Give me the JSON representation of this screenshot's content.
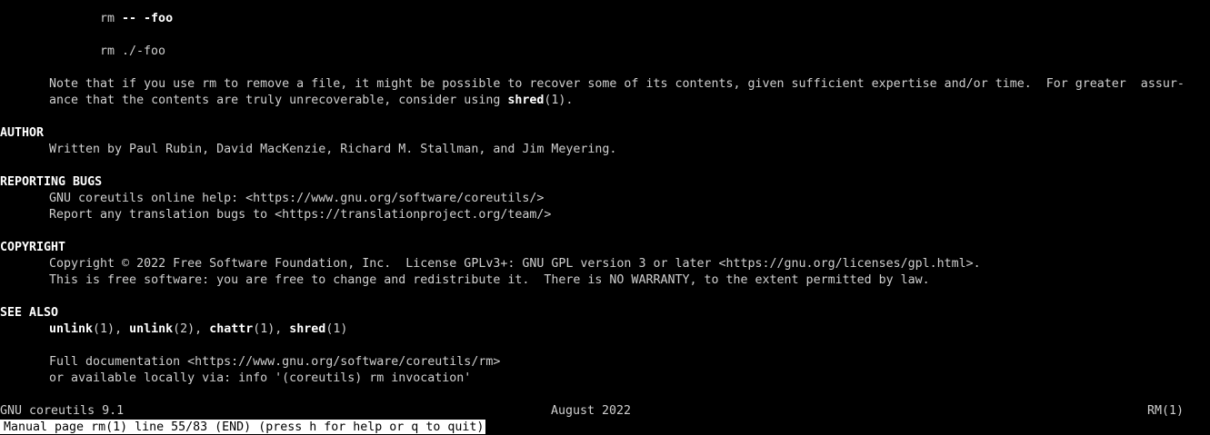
{
  "example": {
    "line1_cmd": "rm",
    "line1_sep": " -- ",
    "line1_arg": "-foo",
    "line2": "rm ./-foo"
  },
  "note": {
    "line1": "Note that if you use rm to remove a file, it might be possible to recover some of its contents, given sufficient expertise and/or time.  For greater  assur-",
    "line2_pre": "ance that the contents are truly unrecoverable, consider using ",
    "line2_cmd": "shred",
    "line2_post": "(1)."
  },
  "author": {
    "heading": "AUTHOR",
    "text": "Written by Paul Rubin, David MacKenzie, Richard M. Stallman, and Jim Meyering."
  },
  "bugs": {
    "heading": "REPORTING BUGS",
    "line1": "GNU coreutils online help: <https://www.gnu.org/software/coreutils/>",
    "line2": "Report any translation bugs to <https://translationproject.org/team/>"
  },
  "copyright": {
    "heading": "COPYRIGHT",
    "line1": "Copyright © 2022 Free Software Foundation, Inc.  License GPLv3+: GNU GPL version 3 or later <https://gnu.org/licenses/gpl.html>.",
    "line2": "This is free software: you are free to change and redistribute it.  There is NO WARRANTY, to the extent permitted by law."
  },
  "see_also": {
    "heading": "SEE ALSO",
    "refs": [
      {
        "name": "unlink",
        "section": "(1)",
        "sep": ", "
      },
      {
        "name": "unlink",
        "section": "(2)",
        "sep": ", "
      },
      {
        "name": "chattr",
        "section": "(1)",
        "sep": ", "
      },
      {
        "name": "shred",
        "section": "(1)",
        "sep": ""
      }
    ],
    "doc_line1": "Full documentation <https://www.gnu.org/software/coreutils/rm>",
    "doc_line2": "or available locally via: info '(coreutils) rm invocation'"
  },
  "footer": {
    "left": "GNU coreutils 9.1",
    "center": "August 2022",
    "right": "RM(1)"
  },
  "status_bar": {
    "text": "Manual page rm(1) line 55/83 (END) (press h for help or q to quit)"
  },
  "colors": {
    "background": "#000000",
    "foreground": "#d0d0d0",
    "bold": "#ffffff",
    "status_bg": "#ffffff",
    "status_fg": "#000000"
  }
}
